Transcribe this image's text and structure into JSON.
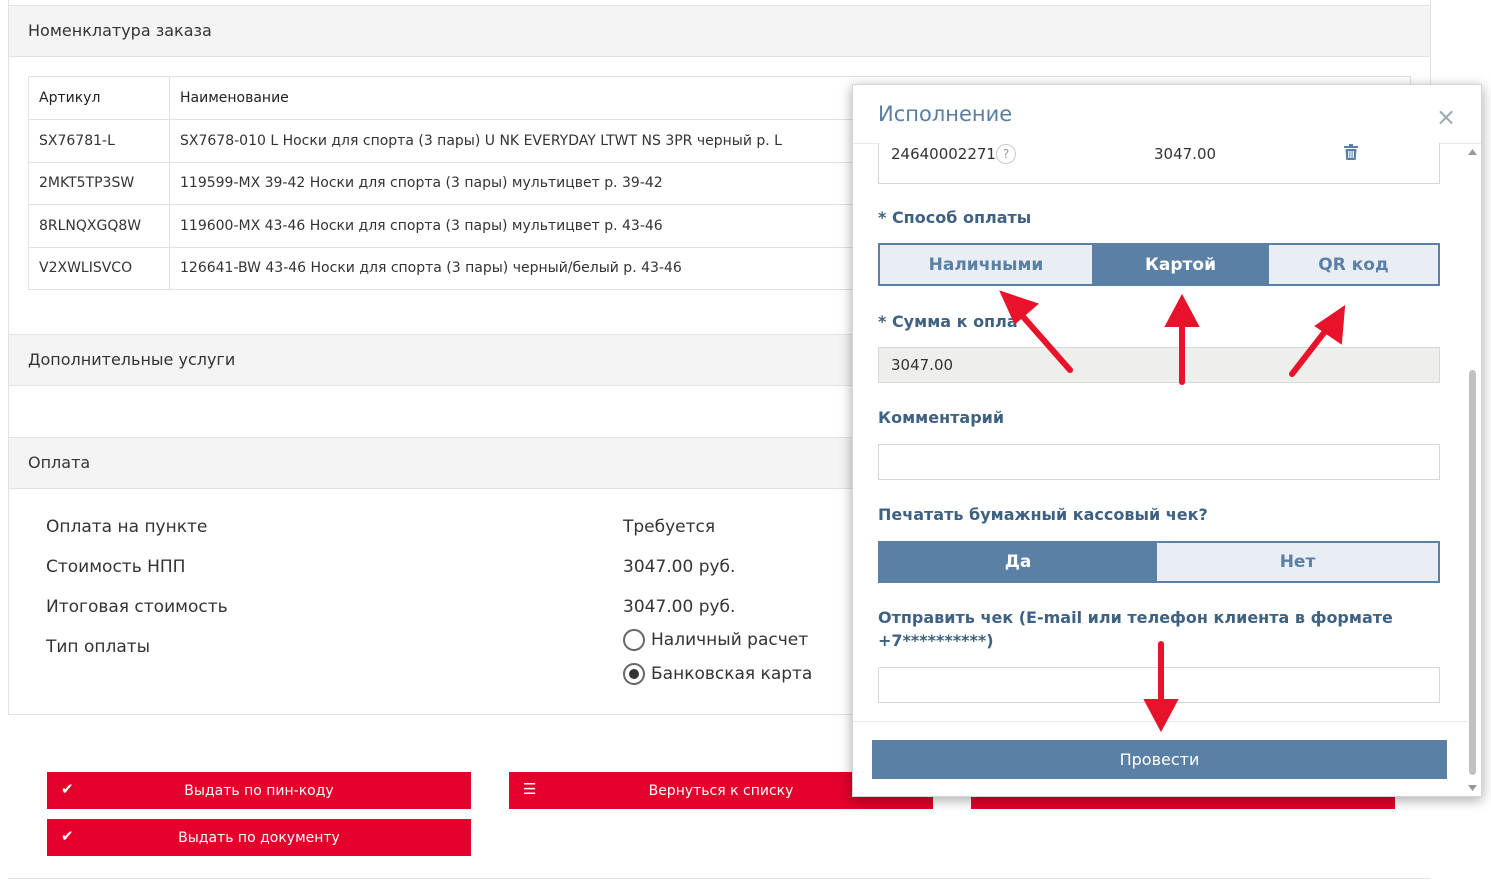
{
  "order": {
    "title": "Номенклатура заказа",
    "columns": [
      "Артикул",
      "Наименование"
    ],
    "rows": [
      {
        "sku": "SX76781-L",
        "name": "SX7678-010 L Носки для спорта (3 пары) U NK EVERYDAY LTWT NS 3PR черный р. L"
      },
      {
        "sku": "2MKT5TP3SW",
        "name": "119599-MX 39-42 Носки для спорта (3 пары) мультицвет р. 39-42"
      },
      {
        "sku": "8RLNQXGQ8W",
        "name": "119600-MX 43-46 Носки для спорта (3 пары) мультицвет р. 43-46"
      },
      {
        "sku": "V2XWLISVCO",
        "name": "126641-BW 43-46 Носки для спорта (3 пары) черный/белый р. 43-46"
      }
    ]
  },
  "services": {
    "title": "Дополнительные услуги"
  },
  "payment": {
    "title": "Оплата",
    "rows": [
      {
        "label": "Оплата на пункте",
        "value": "Требуется"
      },
      {
        "label": "Стоимость НПП",
        "value": "3047.00 руб."
      },
      {
        "label": "Итоговая стоимость",
        "value": "3047.00 руб."
      },
      {
        "label": "Тип оплаты",
        "value": ""
      }
    ],
    "options": [
      "Наличный расчет",
      "Банковская карта"
    ],
    "selected": "Банковская карта"
  },
  "actions": {
    "issue_pin": "Выдать по пин-коду",
    "back_to_list": "Вернуться к списку",
    "issue_doc": "Выдать по документу"
  },
  "modal": {
    "title": "Исполнение",
    "close": "×",
    "code_row": {
      "code": "24640002271",
      "help": "?",
      "amount": "3047.00"
    },
    "method_label": "* Способ оплаты",
    "methods": [
      "Наличными",
      "Картой",
      "QR код"
    ],
    "method_selected": "Картой",
    "amount_label": "* Сумма к опла",
    "amount_value": "3047.00",
    "comment_label": "Комментарий",
    "comment_value": "",
    "print_label": "Печатать бумажный кассовый чек?",
    "print_options": [
      "Да",
      "Нет"
    ],
    "print_selected": "Да",
    "send_label_1": "Отправить чек (E-mail или телефон клиента в формате",
    "send_label_2": "+7**********)",
    "send_value": "",
    "submit": "Провести"
  },
  "colors": {
    "brand_red": "#e4002b",
    "modal_blue": "#5b80a6",
    "arrow_red": "#e8132a"
  }
}
